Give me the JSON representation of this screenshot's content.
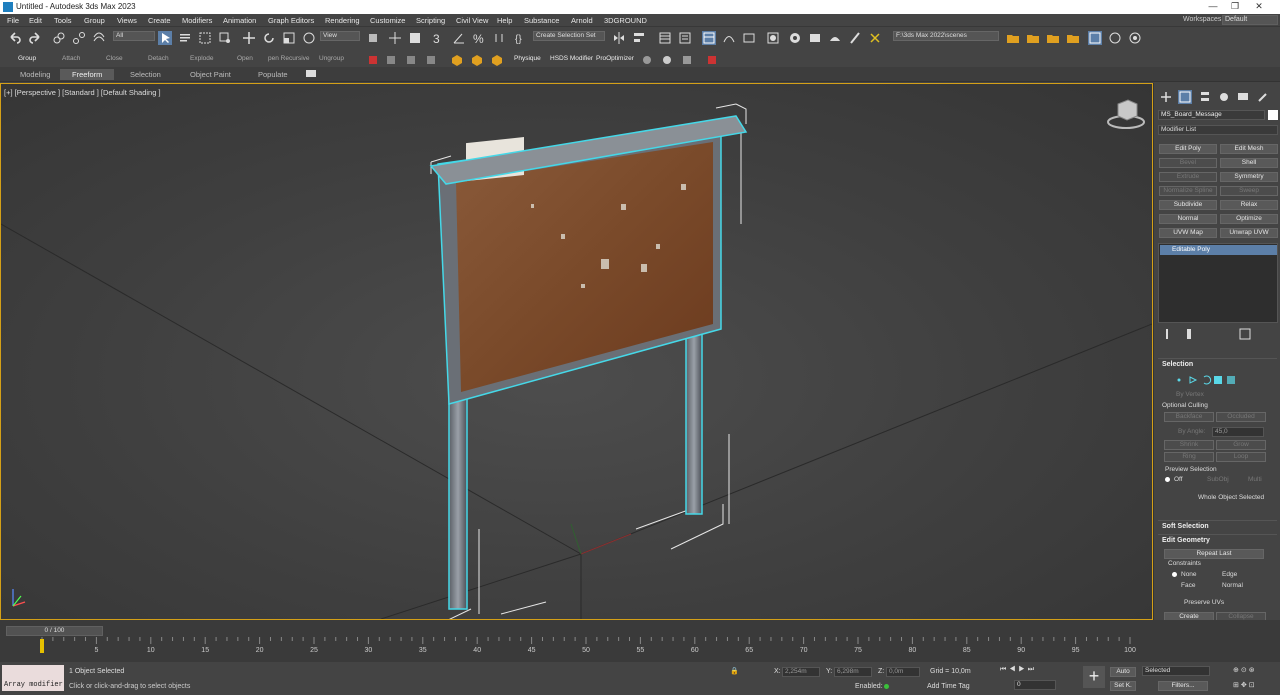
{
  "window": {
    "title": "Untitled - Autodesk 3ds Max 2023",
    "min": "—",
    "restore": "❐",
    "close": "✕"
  },
  "menu": {
    "items": [
      "File",
      "Edit",
      "Tools",
      "Group",
      "Views",
      "Create",
      "Modifiers",
      "Animation",
      "Graph Editors",
      "Rendering",
      "Customize",
      "Scripting",
      "Civil View",
      "Help",
      "Substance",
      "Arnold",
      "3DGROUND"
    ],
    "workspace_label": "Workspaces:",
    "workspace_value": "Default"
  },
  "toolbar": {
    "filter": "All",
    "refcoord": "View",
    "selection_set": "Create Selection Set",
    "project_path": "F:\\3ds Max 2022\\scenes"
  },
  "subtoolbar": {
    "labels": [
      "Group",
      "Attach",
      "Close",
      "Detach",
      "Explode",
      "Open",
      "pen Recursive",
      "Ungroup"
    ],
    "plugins": [
      "Physique",
      "HSDS Modifier",
      "ProOptimizer"
    ]
  },
  "ribbon": {
    "tabs": [
      "Modeling",
      "Freeform",
      "Selection",
      "Object Paint",
      "Populate"
    ],
    "active": "Freeform"
  },
  "viewport": {
    "label": "[+] [Perspective ] [Standard ] [Default Shading ]"
  },
  "cmd": {
    "object_name": "MS_Board_Message",
    "modifier_list": "Modifier List",
    "buttons": [
      [
        "Edit Poly",
        "Edit Mesh"
      ],
      [
        "Bevel",
        "Shell"
      ],
      [
        "Extrude",
        "Symmetry"
      ],
      [
        "Normalize Spline",
        "Sweep"
      ],
      [
        "Subdivide",
        "Relax"
      ],
      [
        "Normal",
        "Optimize"
      ],
      [
        "UVW Map",
        "Unwrap UVW"
      ]
    ],
    "disabled": [
      "Bevel",
      "Extrude",
      "Normalize Spline",
      "Sweep"
    ],
    "stack_item": "Editable Poly",
    "selection": {
      "header": "Selection",
      "by_vertex": "By Vertex",
      "optional_culling": "Optional Culling",
      "backface": "Backface",
      "occluded": "Occluded",
      "by_angle": "By Angle:",
      "angle_value": "45,0",
      "shrink": "Shrink",
      "grow": "Grow",
      "ring": "Ring",
      "loop": "Loop",
      "preview_selection": "Preview Selection",
      "off": "Off",
      "subobj": "SubObj",
      "multi": "Multi",
      "whole_object": "Whole Object Selected"
    },
    "soft_selection": "Soft Selection",
    "edit_geometry": {
      "header": "Edit Geometry",
      "repeat_last": "Repeat Last",
      "constraints": "Constraints",
      "none": "None",
      "edge": "Edge",
      "face": "Face",
      "normal": "Normal",
      "preserve_uvs": "Preserve UVs",
      "create": "Create",
      "collapse": "Collapse"
    }
  },
  "timeline": {
    "slider": "0 / 100",
    "ticks": [
      "0",
      "5",
      "10",
      "15",
      "20",
      "25",
      "30",
      "35",
      "40",
      "45",
      "50",
      "55",
      "60",
      "65",
      "70",
      "75",
      "80",
      "85",
      "90",
      "95",
      "100"
    ]
  },
  "status": {
    "maxscript": "Array modifier",
    "objects": "1 Object Selected",
    "prompt": "Click or click-and-drag to select objects",
    "x_label": "X:",
    "x_value": "2,254m",
    "y_label": "Y:",
    "y_value": "6,298m",
    "z_label": "Z:",
    "z_value": "0,0m",
    "grid": "Grid = 10,0m",
    "enabled": "Enabled:",
    "add_time_tag": "Add Time Tag",
    "auto": "Auto",
    "set_key": "Set K.",
    "selected": "Selected",
    "filters": "Filters...",
    "frame": "0"
  }
}
